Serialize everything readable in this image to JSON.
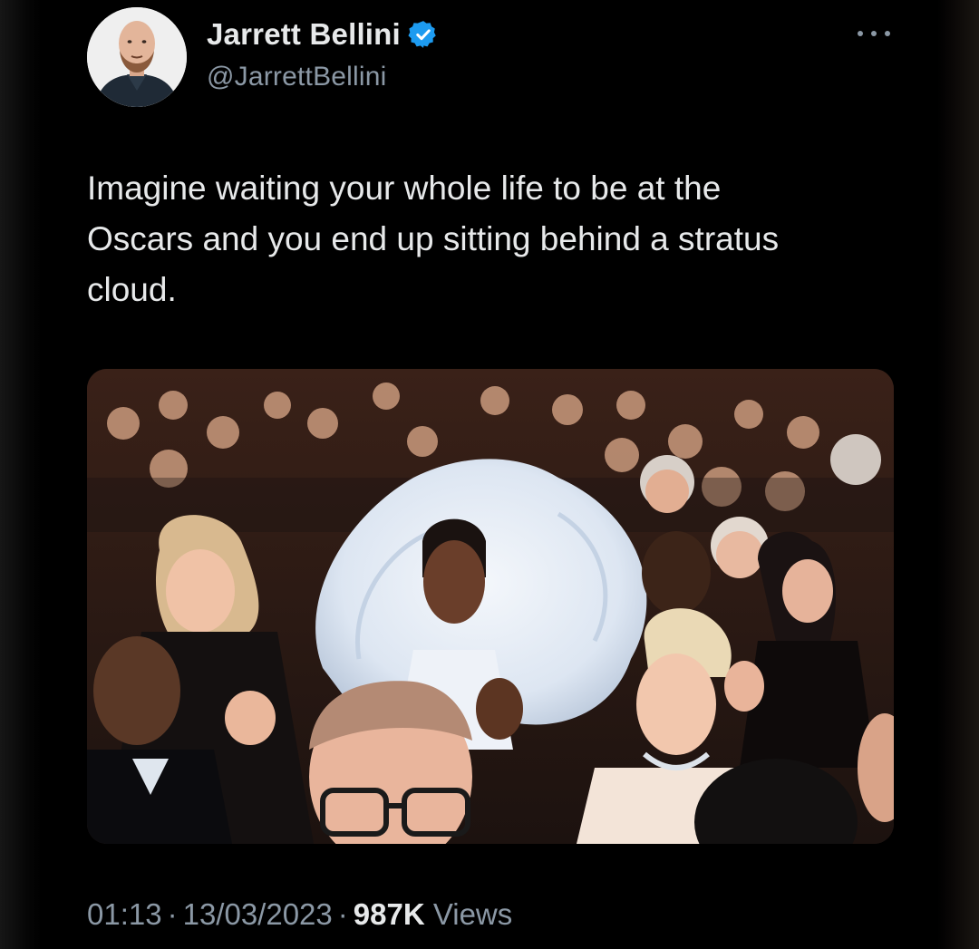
{
  "author": {
    "display_name": "Jarrett Bellini",
    "handle": "@JarrettBellini",
    "verified": true,
    "verified_icon": "verified-badge-icon"
  },
  "tweet": {
    "text": "Imagine waiting your whole life to be at the\nOscars and you end up sitting behind a stratus\ncloud."
  },
  "meta": {
    "time": "01:13",
    "date": "13/03/2023",
    "separator": "·",
    "views_count": "987K",
    "views_label": "Views"
  },
  "colors": {
    "background": "#000000",
    "text_primary": "#e7e9ea",
    "text_secondary": "#8b98a5",
    "verified_blue": "#1d9bf0"
  }
}
